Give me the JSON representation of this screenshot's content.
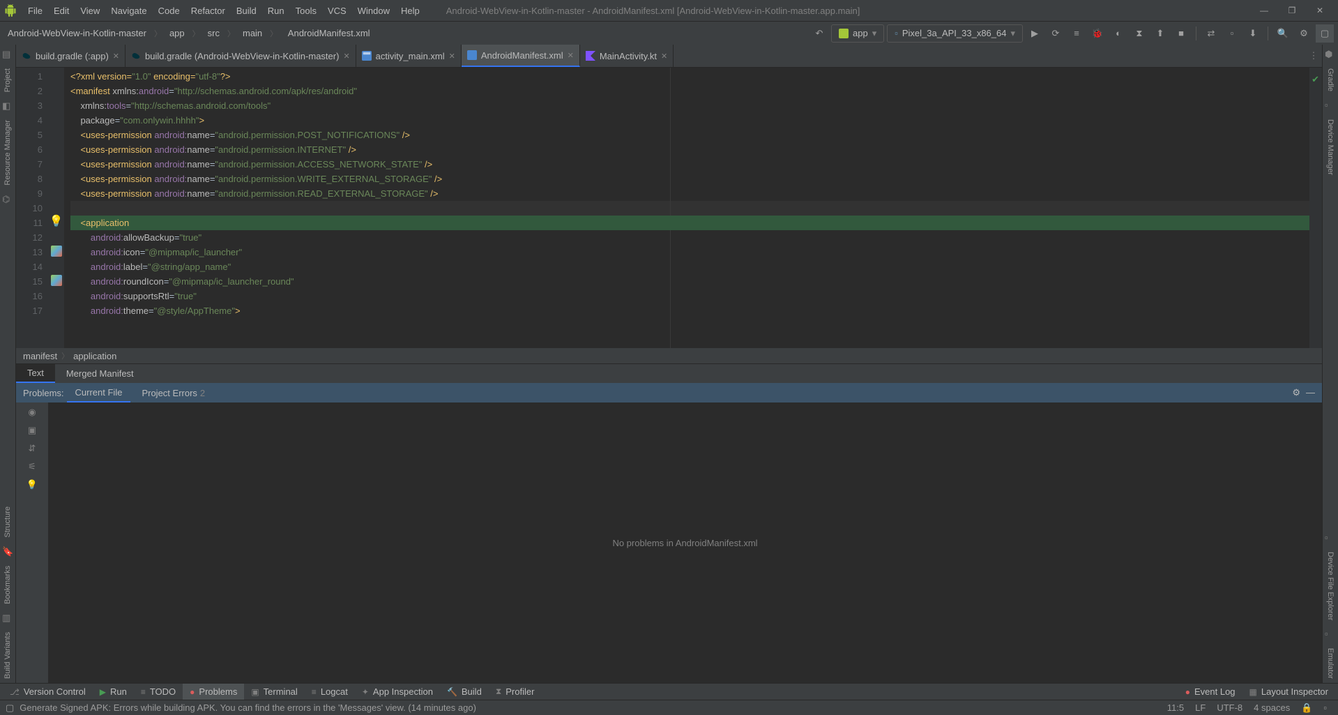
{
  "window": {
    "title": "Android-WebView-in-Kotlin-master - AndroidManifest.xml [Android-WebView-in-Kotlin-master.app.main]"
  },
  "menu": {
    "items": [
      "File",
      "Edit",
      "View",
      "Navigate",
      "Code",
      "Refactor",
      "Build",
      "Run",
      "Tools",
      "VCS",
      "Window",
      "Help"
    ]
  },
  "breadcrumb": {
    "items": [
      "Android-WebView-in-Kotlin-master",
      "app",
      "src",
      "main",
      "AndroidManifest.xml"
    ]
  },
  "runconfig": {
    "app": "app",
    "device": "Pixel_3a_API_33_x86_64"
  },
  "leftgutter": [
    "Project",
    "Resource Manager",
    "Structure",
    "Bookmarks",
    "Build Variants"
  ],
  "rightgutter": [
    "Gradle",
    "Device Manager",
    "Device File Explorer",
    "Emulator"
  ],
  "tabs": [
    {
      "label": "build.gradle (:app)",
      "active": false,
      "pinnable": true
    },
    {
      "label": "build.gradle (Android-WebView-in-Kotlin-master)",
      "active": false,
      "pinnable": true
    },
    {
      "label": "activity_main.xml",
      "active": false,
      "pinnable": true
    },
    {
      "label": "AndroidManifest.xml",
      "active": true,
      "pinnable": true
    },
    {
      "label": "MainActivity.kt",
      "active": false,
      "pinnable": true
    }
  ],
  "editor": {
    "lines": [
      1,
      2,
      3,
      4,
      5,
      6,
      7,
      8,
      9,
      10,
      11,
      12,
      13,
      14,
      15,
      16,
      17
    ],
    "code": {
      "l1a": "<?xml version=",
      "l1b": "\"1.0\"",
      "l1c": " encoding=",
      "l1d": "\"utf-8\"",
      "l1e": "?>",
      "l2a": "<manifest ",
      "l2ns": "xmlns:",
      "l2b": "android",
      "l2eq": "=",
      "l2c": "\"http://schemas.android.com/apk/res/android\"",
      "l3ns": "xmlns:",
      "l3a": "tools",
      "l3eq": "=",
      "l3b": "\"http://schemas.android.com/tools\"",
      "l4a": "package",
      "l4eq": "=",
      "l4b": "\"com.onlywin.hhhh\"",
      "l4c": ">",
      "perm_open": "<uses-permission ",
      "perm_attr": "android:",
      "perm_name": "name",
      "perm_eq": "=",
      "perm_close": " />",
      "p5": "\"android.permission.POST_NOTIFICATIONS\"",
      "p6": "\"android.permission.INTERNET\"",
      "p7": "\"android.permission.ACCESS_NETWORK_STATE\"",
      "p8": "\"android.permission.WRITE_EXTERNAL_STORAGE\"",
      "p9": "\"android.permission.READ_EXTERNAL_STORAGE\"",
      "l11": "<application",
      "app_ns": "android:",
      "app_eq": "=",
      "a12k": "allowBackup",
      "a12v": "\"true\"",
      "a13k": "icon",
      "a13v": "\"@mipmap/ic_launcher\"",
      "a14k": "label",
      "a14v": "\"@string/app_name\"",
      "a15k": "roundIcon",
      "a15v": "\"@mipmap/ic_launcher_round\"",
      "a16k": "supportsRtl",
      "a16v": "\"true\"",
      "a17k": "theme",
      "a17v": "\"@style/AppTheme\"",
      "a17c": ">"
    },
    "breadcrumb": [
      "manifest",
      "application"
    ]
  },
  "subtabs": [
    "Text",
    "Merged Manifest"
  ],
  "problems": {
    "label": "Problems:",
    "tabs": [
      {
        "label": "Current File",
        "count": ""
      },
      {
        "label": "Project Errors",
        "count": "2"
      }
    ],
    "empty": "No problems in AndroidManifest.xml"
  },
  "toolwins": {
    "left": [
      {
        "label": "Version Control",
        "icon": "⎇"
      },
      {
        "label": "Run",
        "icon": "▶"
      },
      {
        "label": "TODO",
        "icon": "≡"
      },
      {
        "label": "Problems",
        "icon": "●",
        "active": true,
        "cls": "redsq"
      },
      {
        "label": "Terminal",
        "icon": "▣"
      },
      {
        "label": "Logcat",
        "icon": "≡"
      },
      {
        "label": "App Inspection",
        "icon": "✦"
      },
      {
        "label": "Build",
        "icon": "🔨"
      },
      {
        "label": "Profiler",
        "icon": "⧗"
      }
    ],
    "right": [
      {
        "label": "Event Log",
        "icon": "●",
        "cls": "redsq"
      },
      {
        "label": "Layout Inspector",
        "icon": "▦"
      }
    ]
  },
  "status": {
    "msg": "Generate Signed APK: Errors while building APK. You can find the errors in the 'Messages' view. (14 minutes ago)",
    "pos": "11:5",
    "le": "LF",
    "enc": "UTF-8",
    "indent": "4 spaces"
  }
}
